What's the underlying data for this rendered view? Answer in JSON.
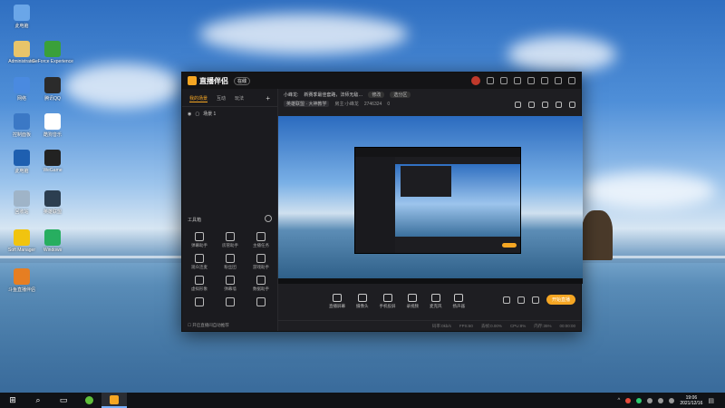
{
  "desktop": {
    "icons": [
      {
        "label": "此电脑",
        "color": "#6aa6e8"
      },
      {
        "label": "Administrator",
        "color": "#e8c46a"
      },
      {
        "label": "GeForce Experience",
        "color": "#3aa03a"
      },
      {
        "label": "网络",
        "color": "#4a8ae0"
      },
      {
        "label": "腾讯QQ",
        "color": "#2b2b2b"
      },
      {
        "label": "控制面板",
        "color": "#3b78c5"
      },
      {
        "label": "酷狗音乐",
        "color": "#ffffff"
      },
      {
        "label": "此电脑",
        "color": "#1e5fb0"
      },
      {
        "label": "WeGame",
        "color": "#222222"
      },
      {
        "label": "回收站",
        "color": "#9fb4c8"
      },
      {
        "label": "英雄联盟",
        "color": "#2c3e50"
      },
      {
        "label": "Soft Manager",
        "color": "#f1c40f"
      },
      {
        "label": "Windows",
        "color": "#27ae60"
      },
      {
        "label": "斗鱼直播伴侣",
        "color": "#e67e22"
      }
    ]
  },
  "app": {
    "title": "直播伴侣",
    "version_badge": "在线",
    "left_tabs": [
      "我的场景",
      "互动",
      "玩法"
    ],
    "scene_name": "场景 1",
    "toolbox_title": "工具箱",
    "tools": [
      "弹幕助手",
      "房管助手",
      "主播任务",
      "观众连麦",
      "粉丝团",
      "游戏助手",
      "虚拟形象",
      "弹幕墙",
      "数据助手",
      "",
      "",
      ""
    ],
    "footer_note": "开启直播间自动推荐",
    "info": {
      "title_prefix": "小峰龙:",
      "title_text": "新赛季最佳套路，法师无敌…",
      "edit_label": "修改",
      "tag_label": "选分区",
      "category": "英雄联盟 · 大神教学",
      "uid_label": "房主:小峰龙",
      "stat_label": "2746324",
      "hot_label": "0"
    },
    "controls": [
      "直播屏幕",
      "摄像头",
      "手机投屏",
      "录视频",
      "麦克风",
      "扬声器"
    ],
    "live_button": "开始直播",
    "status": [
      "码率:0kb/s",
      "FPS:60",
      "丢帧:0.00%",
      "CPU:8%",
      "内存:35%",
      "00:00:00"
    ]
  },
  "taskbar": {
    "time": "19:06",
    "date": "2021/12/16"
  }
}
